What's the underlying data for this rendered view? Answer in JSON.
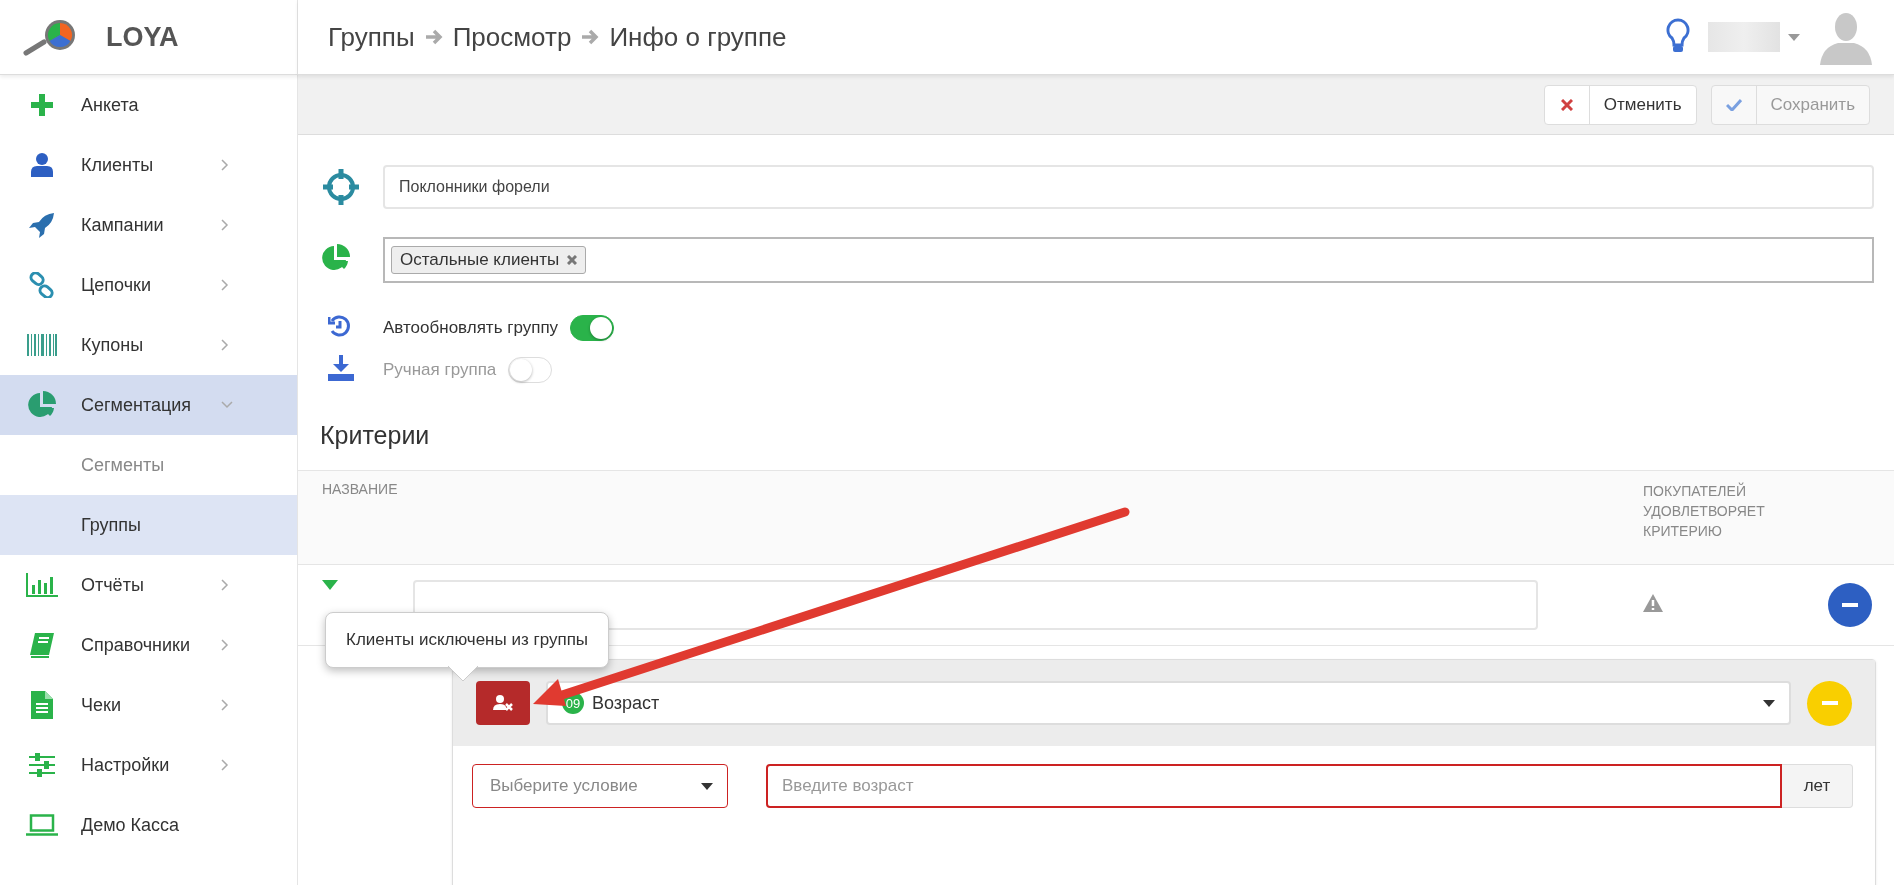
{
  "logo": {
    "text": "LOYA"
  },
  "breadcrumbs": [
    "Группы",
    "Просмотр",
    "Инфо о группе"
  ],
  "sidebar": {
    "items": [
      {
        "label": "Анкета",
        "selected": false
      },
      {
        "label": "Клиенты",
        "expanded": false,
        "selected": false
      },
      {
        "label": "Кампании",
        "expanded": false,
        "selected": false
      },
      {
        "label": "Цепочки",
        "expanded": false,
        "selected": false
      },
      {
        "label": "Купоны",
        "expanded": false,
        "selected": false
      },
      {
        "label": "Сегментация",
        "expanded": true,
        "selected": true,
        "children": [
          {
            "label": "Сегменты",
            "selected": false
          },
          {
            "label": "Группы",
            "selected": true
          }
        ]
      },
      {
        "label": "Отчёты",
        "expanded": false,
        "selected": false
      },
      {
        "label": "Справочники",
        "expanded": false,
        "selected": false
      },
      {
        "label": "Чеки",
        "expanded": false,
        "selected": false
      },
      {
        "label": "Настройки",
        "expanded": false,
        "selected": false
      },
      {
        "label": "Демо Касса",
        "selected": false
      }
    ]
  },
  "toolbar": {
    "buttons": [
      {
        "label": "Отменить",
        "kind": "cancel",
        "disabled": false
      },
      {
        "label": "Сохранить",
        "kind": "save",
        "disabled": true
      }
    ]
  },
  "form": {
    "name_value": "Поклонники форели",
    "segment_tags": [
      "Остальные клиенты"
    ],
    "toggles": [
      {
        "label": "Автообновлять группу",
        "on": true,
        "disabled": false
      },
      {
        "label": "Ручная группа",
        "on": false,
        "disabled": true
      }
    ]
  },
  "criteria": {
    "title": "Критерии",
    "columns": [
      "НАЗВАНИЕ",
      "ПОКУПАТЕЛЕЙ УДОВЛЕТВОРЯЕТ КРИТЕРИЮ"
    ],
    "rows": [
      {
        "warning": true
      }
    ],
    "condition": {
      "excluded": true,
      "tooltip": "Клиенты исключены из группы",
      "badge": "09",
      "field": "Возраст",
      "condition_placeholder": "Выберите условие",
      "value_placeholder": "Введите возраст",
      "unit": "лет",
      "invalid": true
    }
  }
}
